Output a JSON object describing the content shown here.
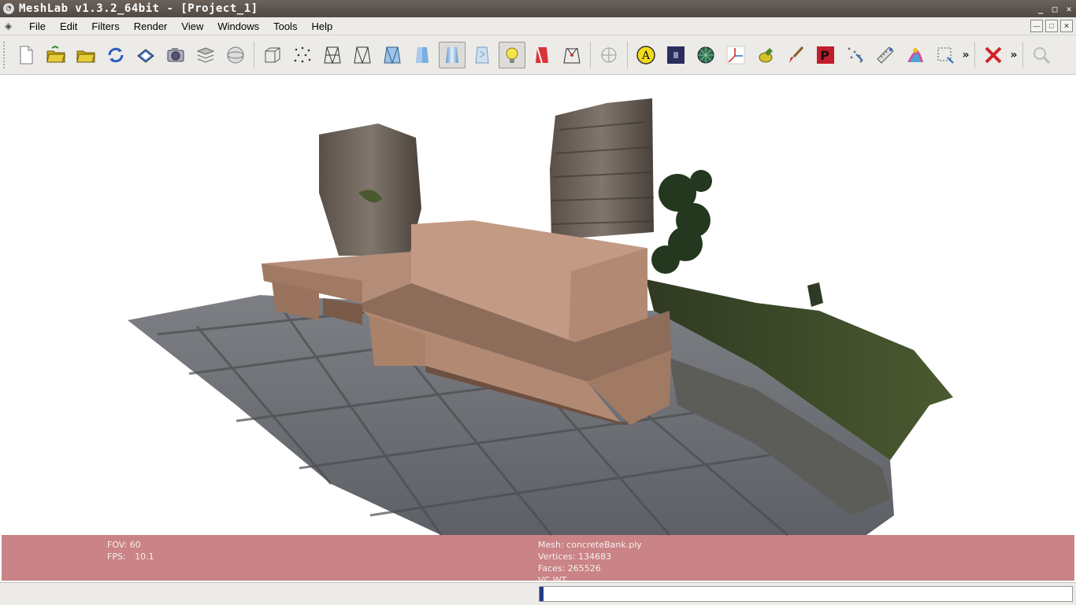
{
  "window": {
    "title": "MeshLab v1.3.2_64bit - [Project_1]",
    "controls": [
      "_",
      "□",
      "✕"
    ]
  },
  "menubar": {
    "items": [
      "File",
      "Edit",
      "Filters",
      "Render",
      "View",
      "Windows",
      "Tools",
      "Help"
    ],
    "mdi_controls": [
      "—",
      "□",
      "✕"
    ]
  },
  "toolbar": {
    "more_label": "»",
    "icons": [
      "new-project-icon",
      "open-project-icon",
      "import-mesh-icon",
      "reload-icon",
      "save-icon",
      "snapshot-icon",
      "layers-icon",
      "sphere-view-icon",
      "bbox-icon",
      "points-icon",
      "wireframe-icon",
      "hidden-lines-icon",
      "flat-lines-icon",
      "flat-icon",
      "smooth-icon",
      "texture-icon",
      "light-icon",
      "backface-icon",
      "normals-icon",
      "trackball-icon",
      "annotation-icon",
      "filter-bg-icon",
      "sphere-mesh-icon",
      "axis-icon",
      "align-icon",
      "paint-icon",
      "parameterize-icon",
      "pick-points-icon",
      "measure-icon",
      "colorize-icon",
      "select-icon",
      "close-icon",
      "search-icon"
    ]
  },
  "info": {
    "fov_label": "FOV:",
    "fov_value": "60",
    "fps_label": "FPS:",
    "fps_value": "10.1",
    "mesh_label": "Mesh: concreteBank.ply",
    "vertices_label": "Vertices: 134683",
    "faces_label": "Faces: 265526",
    "mode_label": "VC WT"
  },
  "status": {
    "progress": 0.008
  },
  "colors": {
    "accent": "#1f3c88",
    "overlay": "#aa373c"
  }
}
